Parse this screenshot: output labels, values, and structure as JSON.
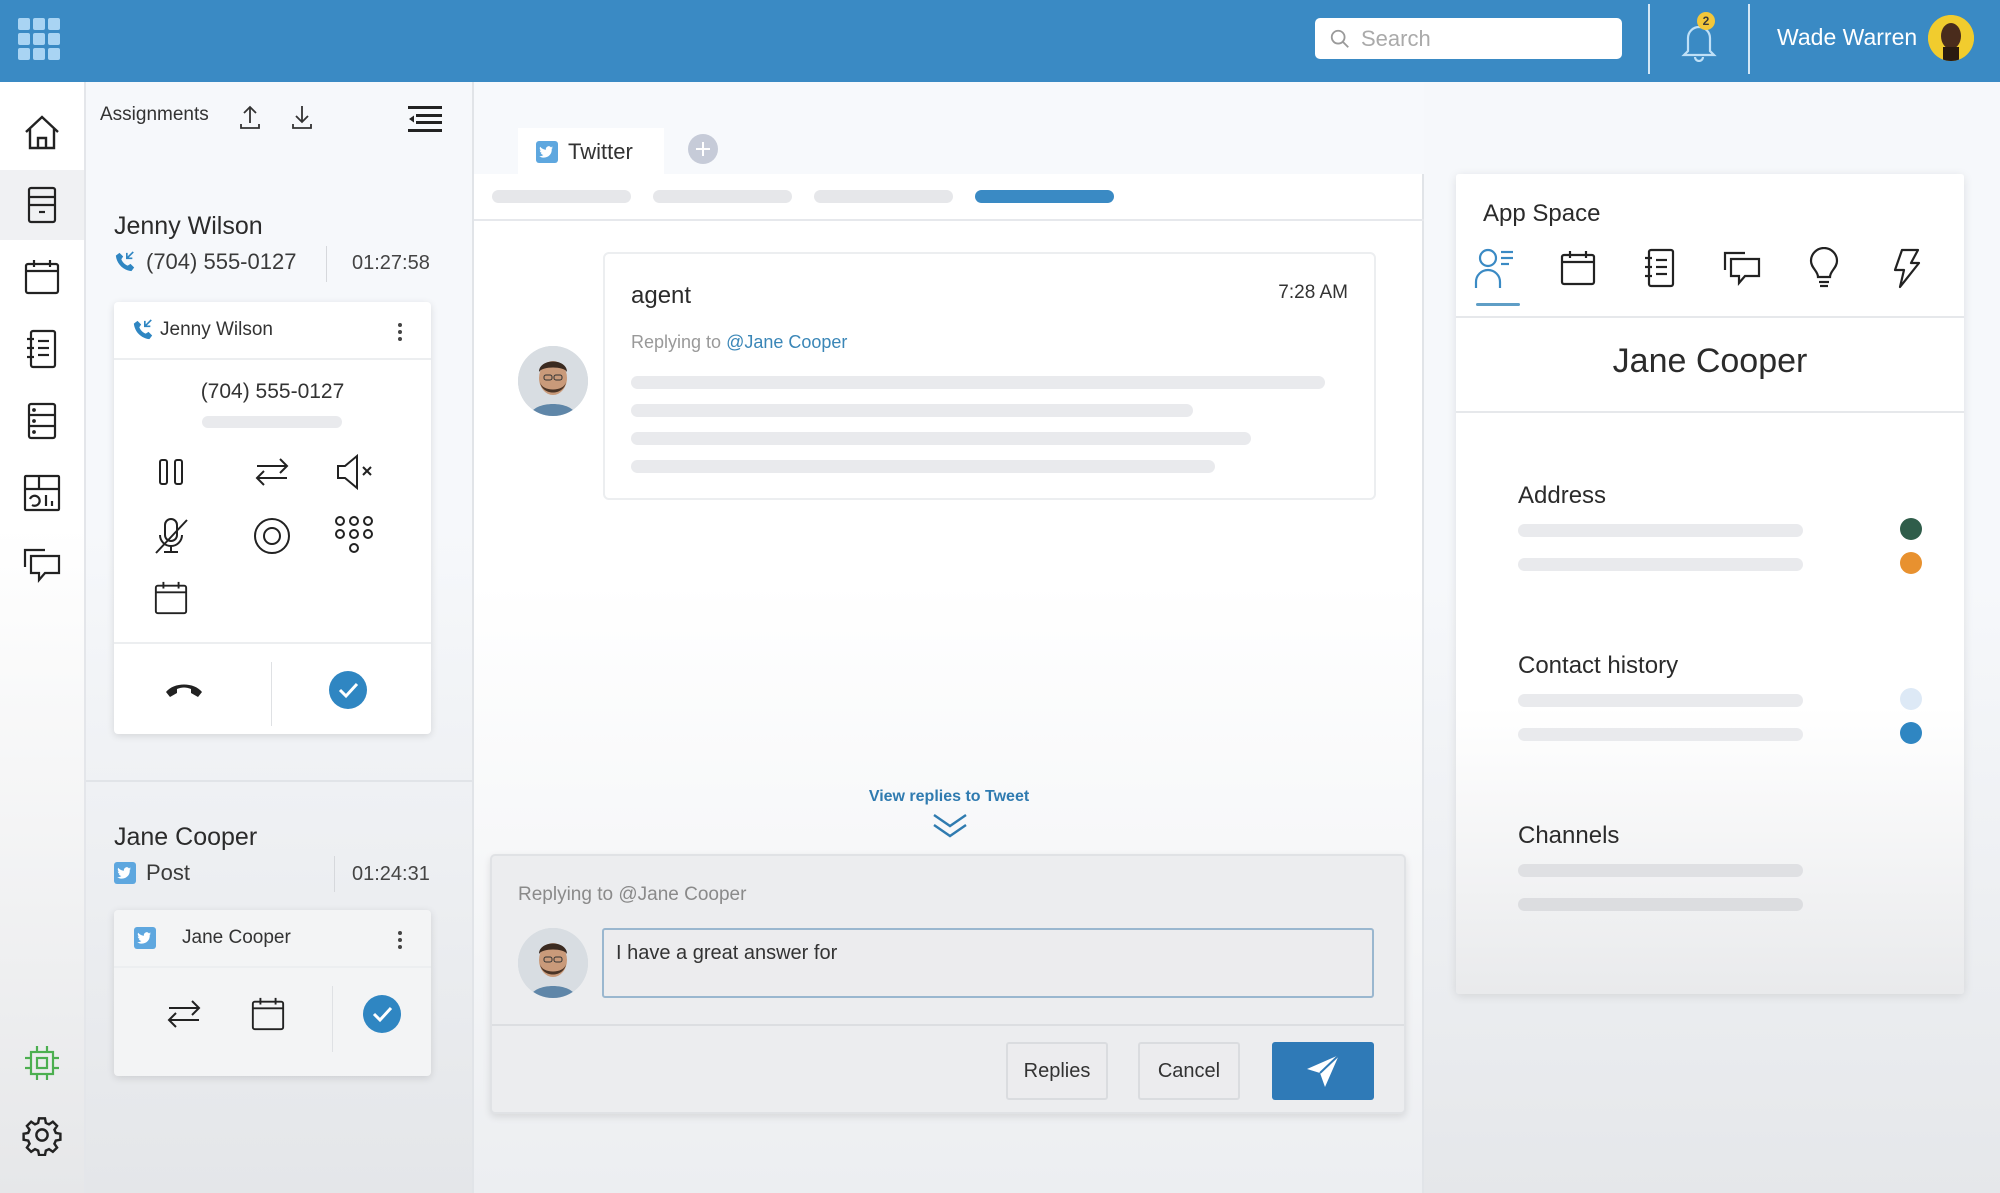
{
  "topbar": {
    "search_placeholder": "Search",
    "notification_count": "2",
    "user_name": "Wade Warren"
  },
  "leftnav": {
    "items": [
      {
        "icon": "home-icon",
        "label": "Home"
      },
      {
        "icon": "cabinet-icon",
        "label": "Cabinet",
        "active": true
      },
      {
        "icon": "calendar-icon",
        "label": "Calendar"
      },
      {
        "icon": "notebook-icon",
        "label": "Notebook"
      },
      {
        "icon": "server-icon",
        "label": "Server"
      },
      {
        "icon": "report-icon",
        "label": "Reports"
      },
      {
        "icon": "chat-icon",
        "label": "Chat"
      }
    ],
    "bottom": [
      {
        "icon": "chip-icon",
        "color": "#4caf50"
      },
      {
        "icon": "gear-icon"
      }
    ]
  },
  "assignments": {
    "title": "Assignments",
    "items": [
      {
        "name": "Jenny Wilson",
        "channel_icon": "incoming-call-icon",
        "subtitle": "(704) 555-0127",
        "duration": "01:27:58",
        "card": {
          "name": "Jenny Wilson",
          "phone": "(704) 555-0127",
          "actions": [
            "pause",
            "transfer",
            "speaker-mute",
            "mic-mute",
            "record",
            "dialpad",
            "schedule"
          ],
          "hangup": "hangup",
          "complete": "complete"
        }
      },
      {
        "name": "Jane Cooper",
        "channel_icon": "twitter-icon",
        "subtitle": "Post",
        "duration": "01:24:31",
        "card": {
          "name": "Jane Cooper",
          "actions": [
            "transfer",
            "schedule"
          ],
          "complete": "complete"
        }
      }
    ]
  },
  "conversation": {
    "tabs": [
      {
        "label": "Twitter",
        "icon": "twitter-icon"
      }
    ],
    "subtabs_active_index": 3,
    "message": {
      "author": "agent",
      "time": "7:28 AM",
      "replying_prefix": "Replying to",
      "mention": "@Jane Cooper"
    },
    "view_replies": "View replies to Tweet",
    "reply": {
      "replying_to": "Replying to @Jane Cooper",
      "input_value": "I have a great answer for",
      "replies_label": "Replies",
      "cancel_label": "Cancel"
    }
  },
  "app_space": {
    "title": "App Space",
    "tabs": [
      "contact-details",
      "calendar",
      "notebook",
      "chat",
      "ideas",
      "automation"
    ],
    "active_tab": 0,
    "contact_name": "Jane Cooper",
    "sections": [
      {
        "title": "Address",
        "dots": [
          "#2f5d4a",
          "#e8912f"
        ]
      },
      {
        "title": "Contact history",
        "dots": [
          "#dde9f6",
          "#2f86c2"
        ]
      },
      {
        "title": "Channels",
        "dots": []
      }
    ]
  },
  "colors": {
    "brand": "#3a8ac4",
    "accent_button": "#2f7ab7",
    "twitter": "#5ea7df",
    "link": "#2f7bb0"
  }
}
